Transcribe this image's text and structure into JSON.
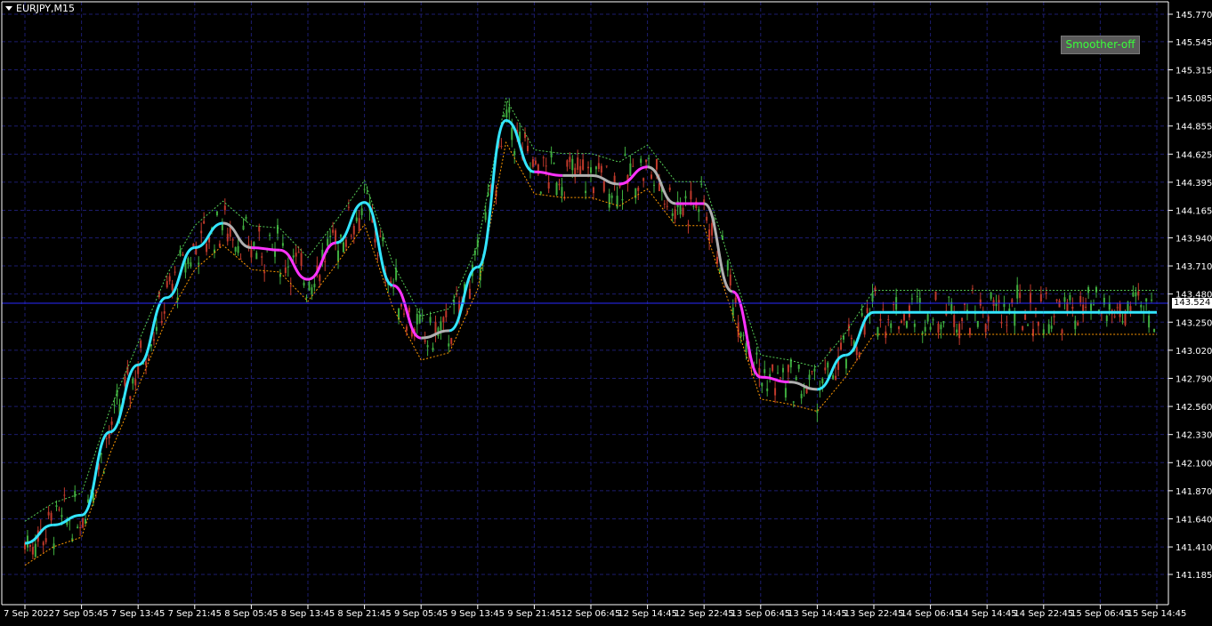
{
  "window": {
    "symbol": "EURJPY,M15",
    "smoother_button": "Smoother-off",
    "current_price_tag": "143.524"
  },
  "colors": {
    "background": "#000000",
    "grid": "#1c1c6e",
    "axis_text": "#ffffff",
    "bull_candle": "#3fae3f",
    "bear_candle": "#c0392b",
    "smoother_up": "#33e5ff",
    "smoother_down": "#ff33ff",
    "smoother_flat": "#b0b0b0",
    "band_green": "#55cc55",
    "band_orange": "#ff9900",
    "price_line": "#2a2aff"
  },
  "chart_data": {
    "type": "line",
    "title": "EURJPY,M15",
    "price_axis_labels": [
      "145.770",
      "145.545",
      "145.315",
      "145.085",
      "144.855",
      "144.625",
      "144.395",
      "144.165",
      "143.940",
      "143.710",
      "143.480",
      "143.250",
      "143.020",
      "142.790",
      "142.560",
      "142.330",
      "142.100",
      "141.870",
      "141.640",
      "141.410",
      "141.185"
    ],
    "time_axis_labels": [
      "7 Sep 2022",
      "7 Sep 05:45",
      "7 Sep 13:45",
      "7 Sep 21:45",
      "8 Sep 05:45",
      "8 Sep 13:45",
      "8 Sep 21:45",
      "9 Sep 05:45",
      "9 Sep 13:45",
      "9 Sep 21:45",
      "12 Sep 06:45",
      "12 Sep 14:45",
      "12 Sep 22:45",
      "13 Sep 06:45",
      "13 Sep 14:45",
      "13 Sep 22:45",
      "14 Sep 06:45",
      "14 Sep 14:45",
      "14 Sep 22:45",
      "15 Sep 06:45",
      "15 Sep 14:45"
    ],
    "ylim": [
      141.185,
      145.77
    ],
    "current_price": 143.524,
    "grid": true,
    "series": [
      {
        "name": "Smoother",
        "x": [
          0,
          0.5,
          1,
          1.5,
          2,
          2.5,
          3,
          3.5,
          4,
          4.5,
          5,
          5.5,
          6,
          6.5,
          7,
          7.5,
          8,
          8.5,
          9,
          9.5,
          10,
          10.5,
          11,
          11.5,
          12,
          12.5,
          13,
          13.5,
          14,
          14.5,
          15,
          15.5,
          16,
          16.5,
          17,
          17.5,
          18,
          18.5,
          19,
          19.5,
          20
        ],
        "values": [
          141.44,
          141.59,
          141.67,
          142.35,
          142.9,
          143.45,
          143.86,
          144.06,
          143.86,
          143.84,
          143.6,
          143.9,
          144.23,
          143.55,
          143.12,
          143.18,
          143.7,
          144.9,
          144.48,
          144.45,
          144.45,
          144.38,
          144.52,
          144.22,
          144.22,
          143.5,
          142.8,
          142.76,
          142.7,
          142.98,
          143.33,
          143.33,
          143.33,
          143.33,
          143.33,
          143.33,
          143.33,
          143.33,
          143.33,
          143.33,
          143.33
        ],
        "colors": [
          "up",
          "up",
          "up",
          "up",
          "up",
          "up",
          "up",
          "flat",
          "down",
          "down",
          "down",
          "up",
          "up",
          "down",
          "flat",
          "up",
          "up",
          "up",
          "down",
          "flat",
          "flat",
          "down",
          "flat",
          "down",
          "flat",
          "down",
          "down",
          "flat",
          "up",
          "up",
          "up",
          "up",
          "up",
          "up",
          "up",
          "up",
          "up",
          "up",
          "up",
          "up",
          "up"
        ]
      }
    ]
  }
}
